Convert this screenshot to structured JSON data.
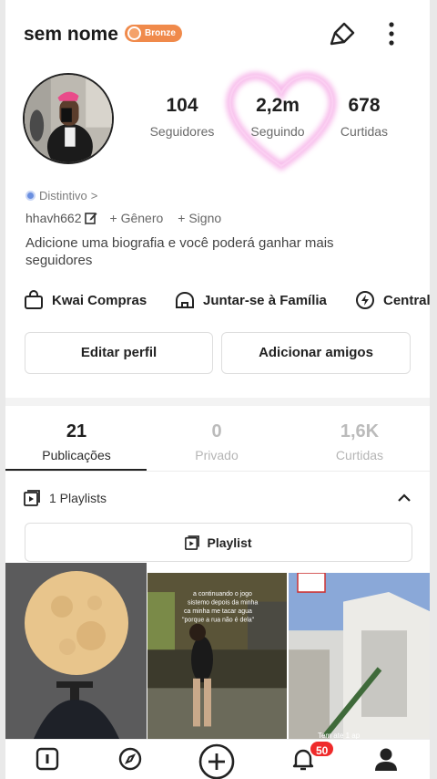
{
  "header": {
    "username": "sem nome",
    "badge": "Bronze"
  },
  "stats": [
    {
      "value": "104",
      "label": "Seguidores"
    },
    {
      "value": "2,2m",
      "label": "Seguindo"
    },
    {
      "value": "678",
      "label": "Curtidas"
    }
  ],
  "profile": {
    "distintivo": "Distintivo",
    "distintivo_arrow": ">",
    "handle": "hhavh662",
    "genero": "+ Gênero",
    "signo": "+ Signo",
    "bio": "Adicione uma biografia e você poderá ganhar mais seguidores"
  },
  "shortcuts": [
    {
      "label": "Kwai Compras",
      "icon": "shopping-bag-icon"
    },
    {
      "label": "Juntar-se à Família",
      "icon": "family-house-icon"
    },
    {
      "label": "Central",
      "icon": "lightning-icon"
    }
  ],
  "buttons": {
    "edit": "Editar perfil",
    "add_friends": "Adicionar amigos"
  },
  "tabs": [
    {
      "count": "21",
      "label": "Publicações",
      "active": true
    },
    {
      "count": "0",
      "label": "Privado",
      "active": false
    },
    {
      "count": "1,6K",
      "label": "Curtidas",
      "active": false
    }
  ],
  "playlists": {
    "header": "1 Playlists",
    "button": "Playlist"
  },
  "thumbnails": [
    {
      "name": "full-moon-christ-statue"
    },
    {
      "name": "woman-walking-street-video",
      "caption_lines": [
        "a continuando o jogo",
        "sistemo depois da minha",
        "ca minha me tacar agua",
        "\"porque a rua não é dela\""
      ]
    },
    {
      "name": "white-building-balcony-video",
      "caption": "Tem ate 1 ap"
    }
  ],
  "bottom_nav": {
    "notifications_count": "50"
  },
  "colors": {
    "badge": "#f08a4b",
    "notif": "#ef2a2a",
    "heart_glow": "#f07ad8"
  }
}
